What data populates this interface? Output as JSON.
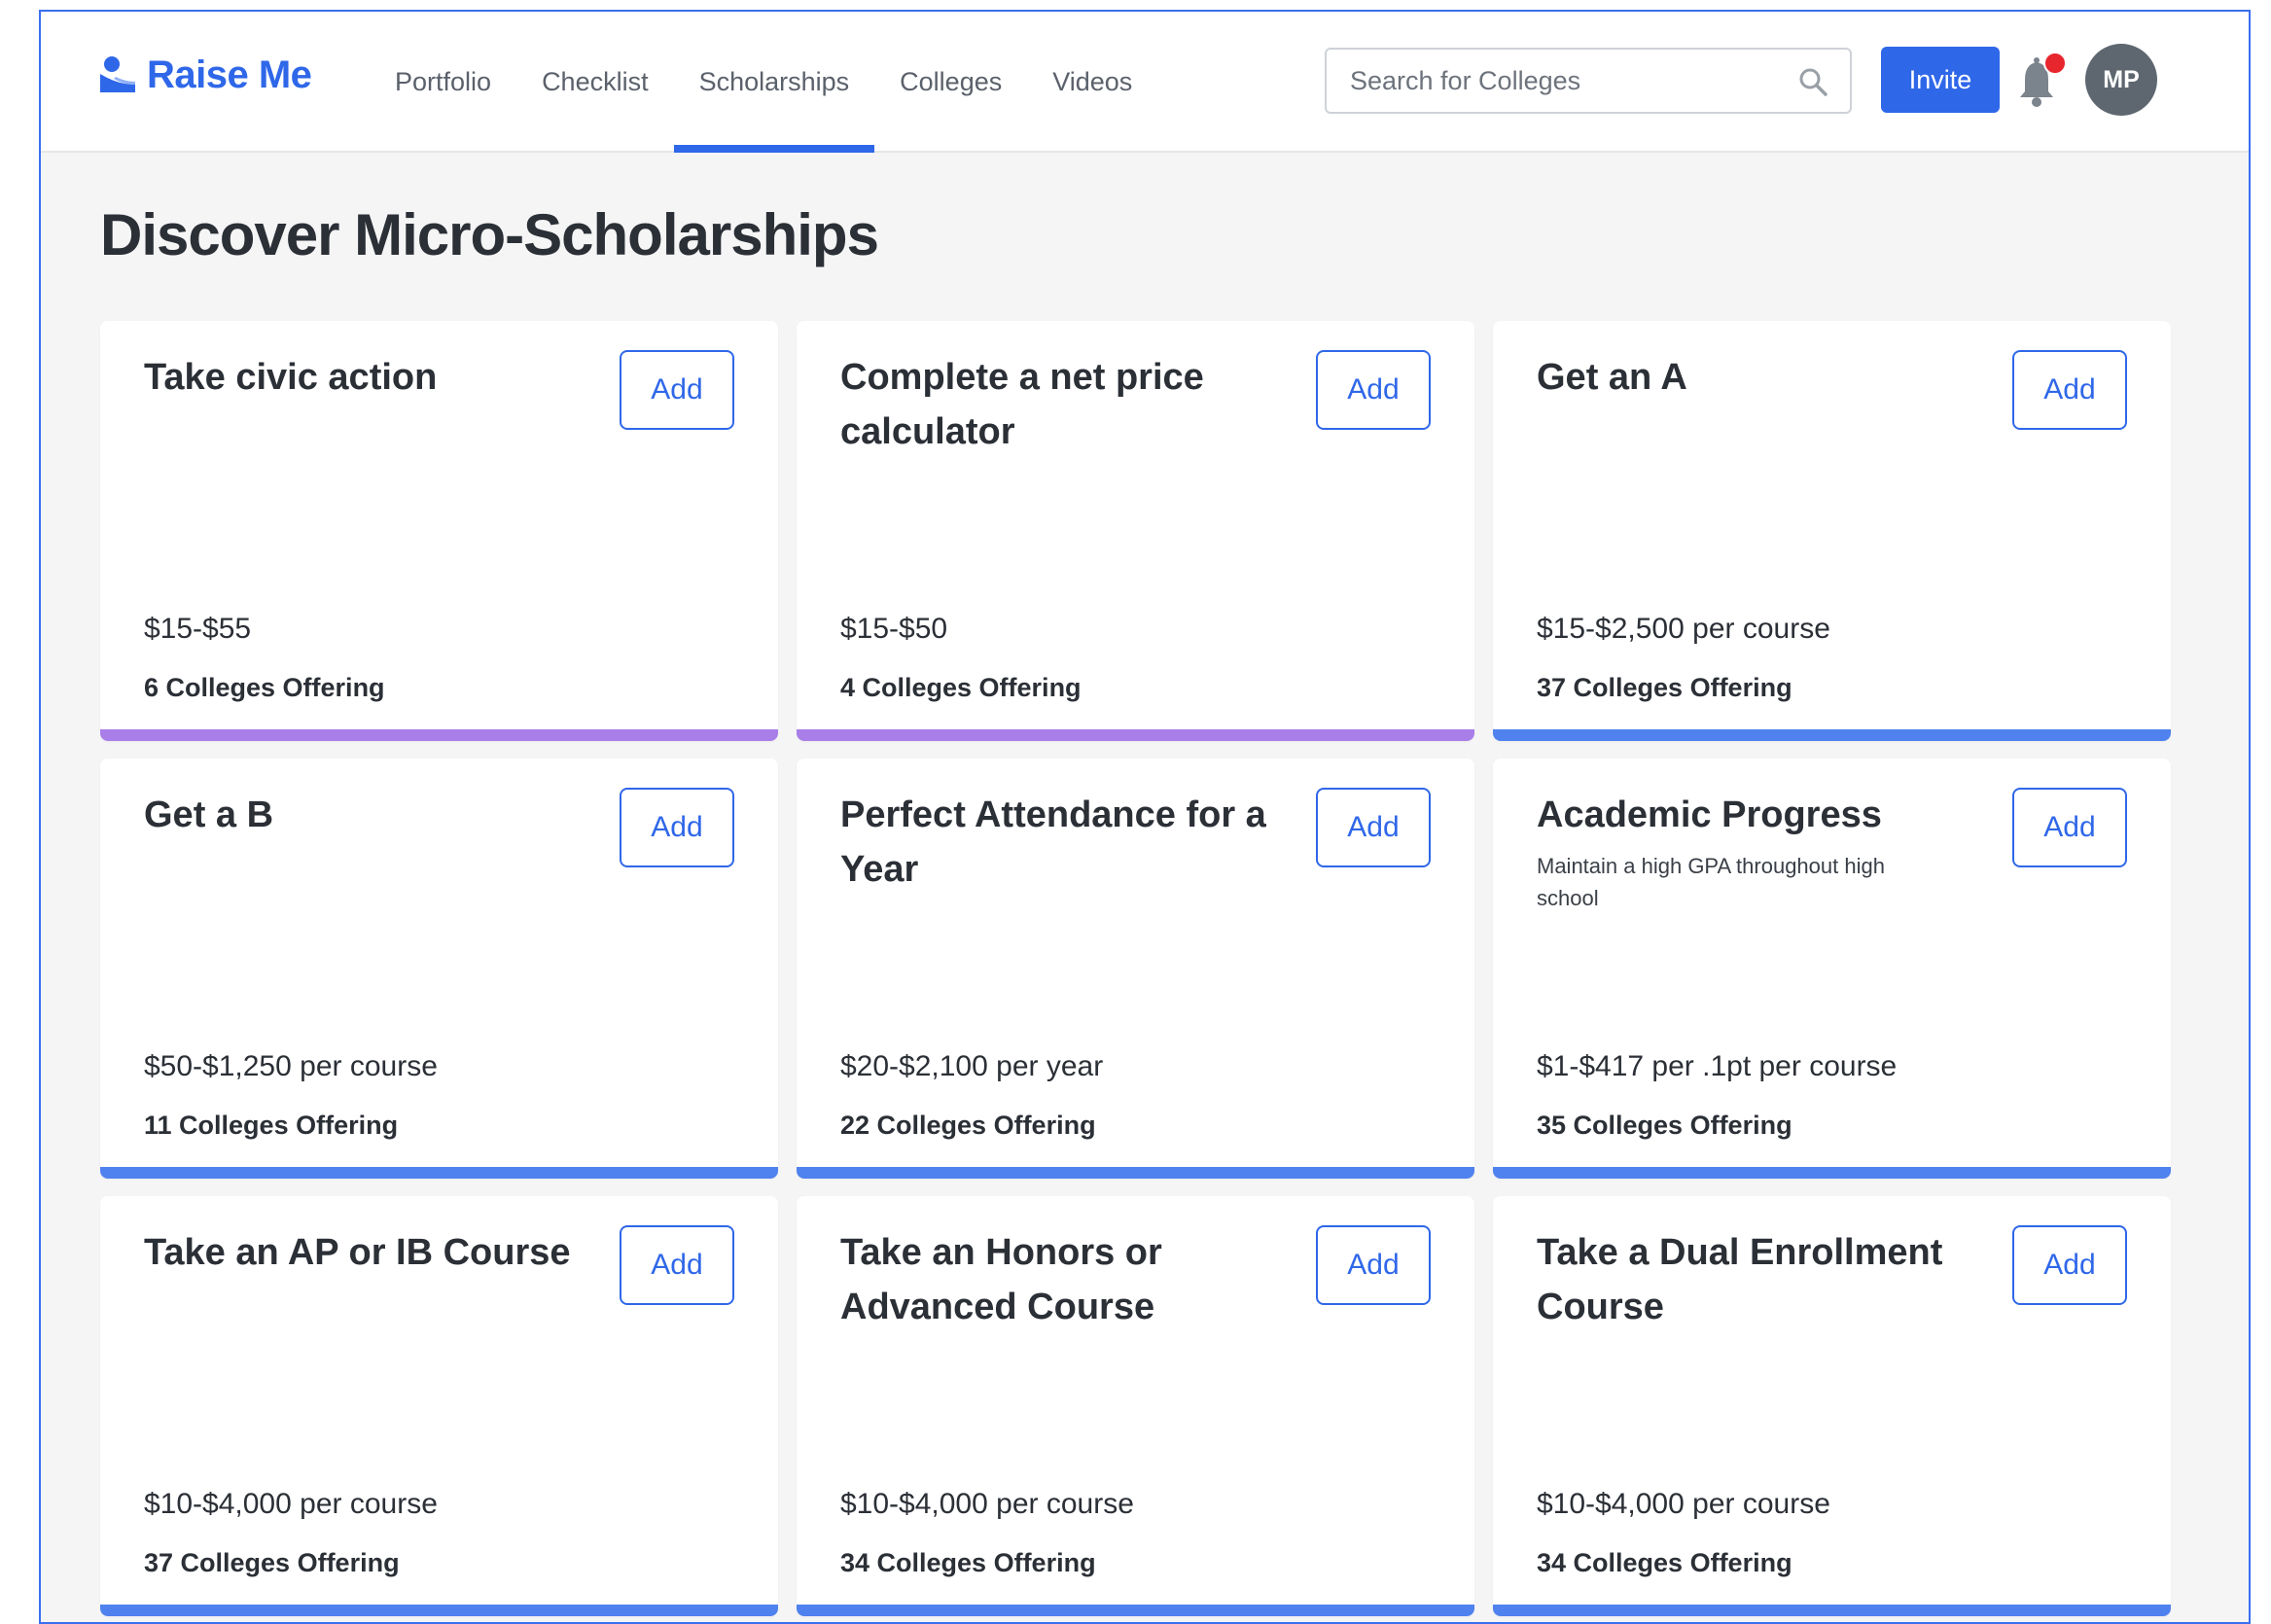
{
  "app": {
    "logo_text": "Raise Me",
    "brand_color": "#2f67e9"
  },
  "nav": {
    "items": [
      {
        "label": "Portfolio",
        "active": false
      },
      {
        "label": "Checklist",
        "active": false
      },
      {
        "label": "Scholarships",
        "active": true
      },
      {
        "label": "Colleges",
        "active": false
      },
      {
        "label": "Videos",
        "active": false
      }
    ]
  },
  "search": {
    "placeholder": "Search for Colleges",
    "value": ""
  },
  "header": {
    "invite_label": "Invite",
    "avatar_initials": "MP",
    "notification_dot_color": "#e8262d"
  },
  "page": {
    "title": "Discover Micro-Scholarships"
  },
  "colors": {
    "purple_accent": "#a97ee8",
    "blue_accent": "#4f82ee"
  },
  "cards": [
    {
      "title": "Take civic action",
      "description": "",
      "amount": "$15-$55",
      "colleges": "6 Colleges Offering",
      "add_label": "Add",
      "accent": "#a97ee8"
    },
    {
      "title": "Complete a net price calculator",
      "description": "",
      "amount": "$15-$50",
      "colleges": "4 Colleges Offering",
      "add_label": "Add",
      "accent": "#a97ee8"
    },
    {
      "title": "Get an A",
      "description": "",
      "amount": "$15-$2,500 per course",
      "colleges": "37 Colleges Offering",
      "add_label": "Add",
      "accent": "#4f82ee"
    },
    {
      "title": "Get a B",
      "description": "",
      "amount": "$50-$1,250 per course",
      "colleges": "11 Colleges Offering",
      "add_label": "Add",
      "accent": "#4f82ee"
    },
    {
      "title": "Perfect Attendance for a Year",
      "description": "",
      "amount": "$20-$2,100 per year",
      "colleges": "22 Colleges Offering",
      "add_label": "Add",
      "accent": "#4f82ee"
    },
    {
      "title": "Academic Progress",
      "description": "Maintain a high GPA throughout high school",
      "amount": "$1-$417 per .1pt per course",
      "colleges": "35 Colleges Offering",
      "add_label": "Add",
      "accent": "#4f82ee"
    },
    {
      "title": "Take an AP or IB Course",
      "description": "",
      "amount": "$10-$4,000 per course",
      "colleges": "37 Colleges Offering",
      "add_label": "Add",
      "accent": "#4f82ee"
    },
    {
      "title": "Take an Honors or Advanced Course",
      "description": "",
      "amount": "$10-$4,000 per course",
      "colleges": "34 Colleges Offering",
      "add_label": "Add",
      "accent": "#4f82ee"
    },
    {
      "title": "Take a Dual Enrollment Course",
      "description": "",
      "amount": "$10-$4,000 per course",
      "colleges": "34 Colleges Offering",
      "add_label": "Add",
      "accent": "#4f82ee"
    }
  ]
}
